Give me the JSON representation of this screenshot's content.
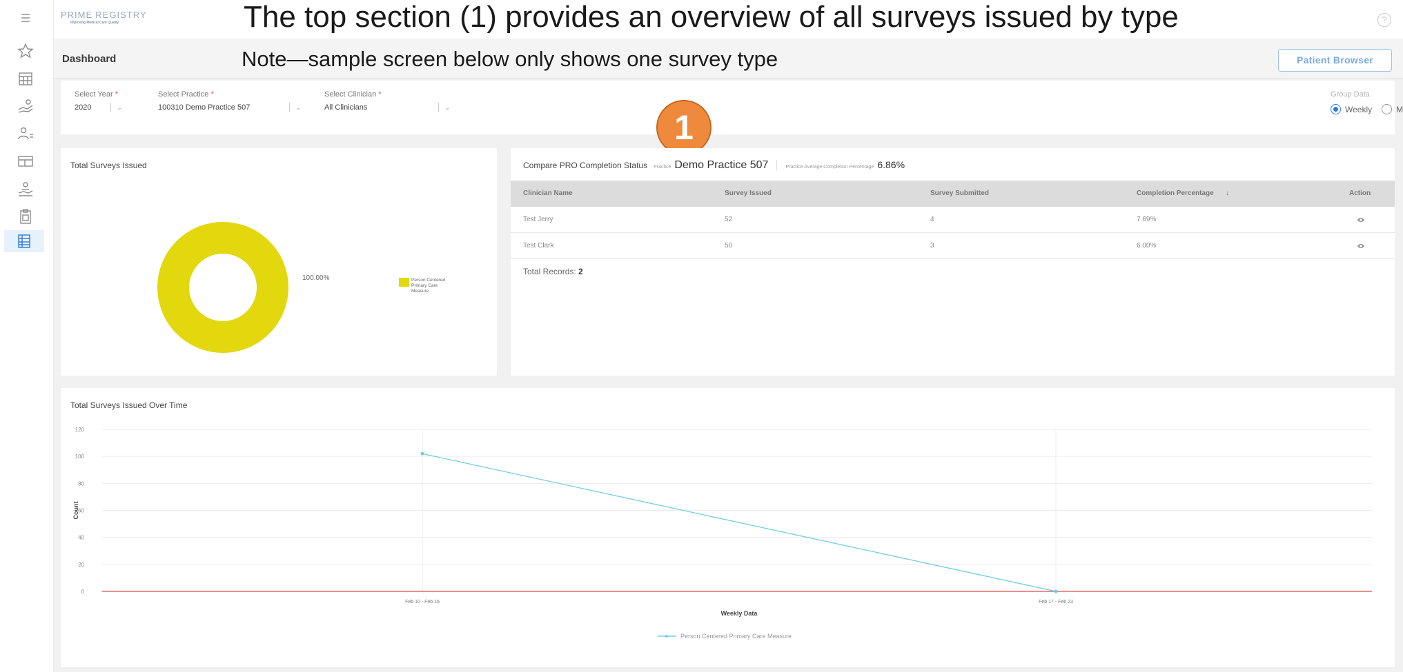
{
  "overlay": {
    "title": "The top section (1) provides an overview of all surveys issued by type",
    "note": "Note—sample screen below only shows one survey type",
    "badge": "1"
  },
  "app": {
    "logo_main": "PRIME",
    "logo_registry": "REGISTRY",
    "logo_tagline": "Improving Medical Care Quality",
    "help_icon": "?"
  },
  "sidebar": {
    "icons": [
      "menu-icon",
      "star-icon",
      "calendar-icon",
      "hand-money-icon",
      "users-icon",
      "card-icon",
      "hand-person-icon",
      "clipboard-icon",
      "list-icon"
    ],
    "active_index": 8
  },
  "header": {
    "title": "Dashboard",
    "patient_browser": "Patient Browser"
  },
  "filters": {
    "year": {
      "label": "Select Year",
      "value": "2020"
    },
    "practice": {
      "label": "Select Practice",
      "value": "100310 Demo Practice 507"
    },
    "clinician": {
      "label": "Select Clinician",
      "value": "All Clinicians"
    },
    "required_mark": "*",
    "group_data": {
      "label": "Group Data",
      "options": [
        "Weekly",
        "Monthly"
      ],
      "selected": "Weekly"
    }
  },
  "donut_card": {
    "title": "Total Surveys Issued",
    "percent_label": "100.00%",
    "legend": "Person Centered Primary Care Measure",
    "color": "#e3d70d"
  },
  "table_card": {
    "title": "Compare PRO Completion Status",
    "practice_label": "Practice",
    "practice_value": "Demo Practice 507",
    "avg_label": "Practice Average Completion Percentage",
    "avg_value": "6.86%",
    "columns": [
      "Clinician Name",
      "Survey Issued",
      "Survey Submitted",
      "Completion Percentage",
      "Action"
    ],
    "sort_icon": "↓",
    "rows": [
      {
        "name": "Test Jerry",
        "issued": "52",
        "submitted": "4",
        "pct": "7.69%"
      },
      {
        "name": "Test Clark",
        "issued": "50",
        "submitted": "3",
        "pct": "6.00%"
      }
    ],
    "total_label": "Total Records:",
    "total_value": "2"
  },
  "chart_data": {
    "type": "line",
    "title": "Total Surveys Issued Over Time",
    "xlabel": "Weekly Data",
    "ylabel": "Count",
    "categories": [
      "Feb 10 - Feb 16",
      "Feb 17 - Feb 23"
    ],
    "series": [
      {
        "name": "Person Centered Primary Care Measure",
        "values": [
          102,
          0
        ],
        "color": "#6fcde0"
      }
    ],
    "ylim": [
      0,
      120
    ],
    "yticks": [
      0,
      20,
      40,
      60,
      80,
      100,
      120
    ],
    "baseline_color": "#e06a6a",
    "grid": true,
    "legend_position": "bottom"
  }
}
